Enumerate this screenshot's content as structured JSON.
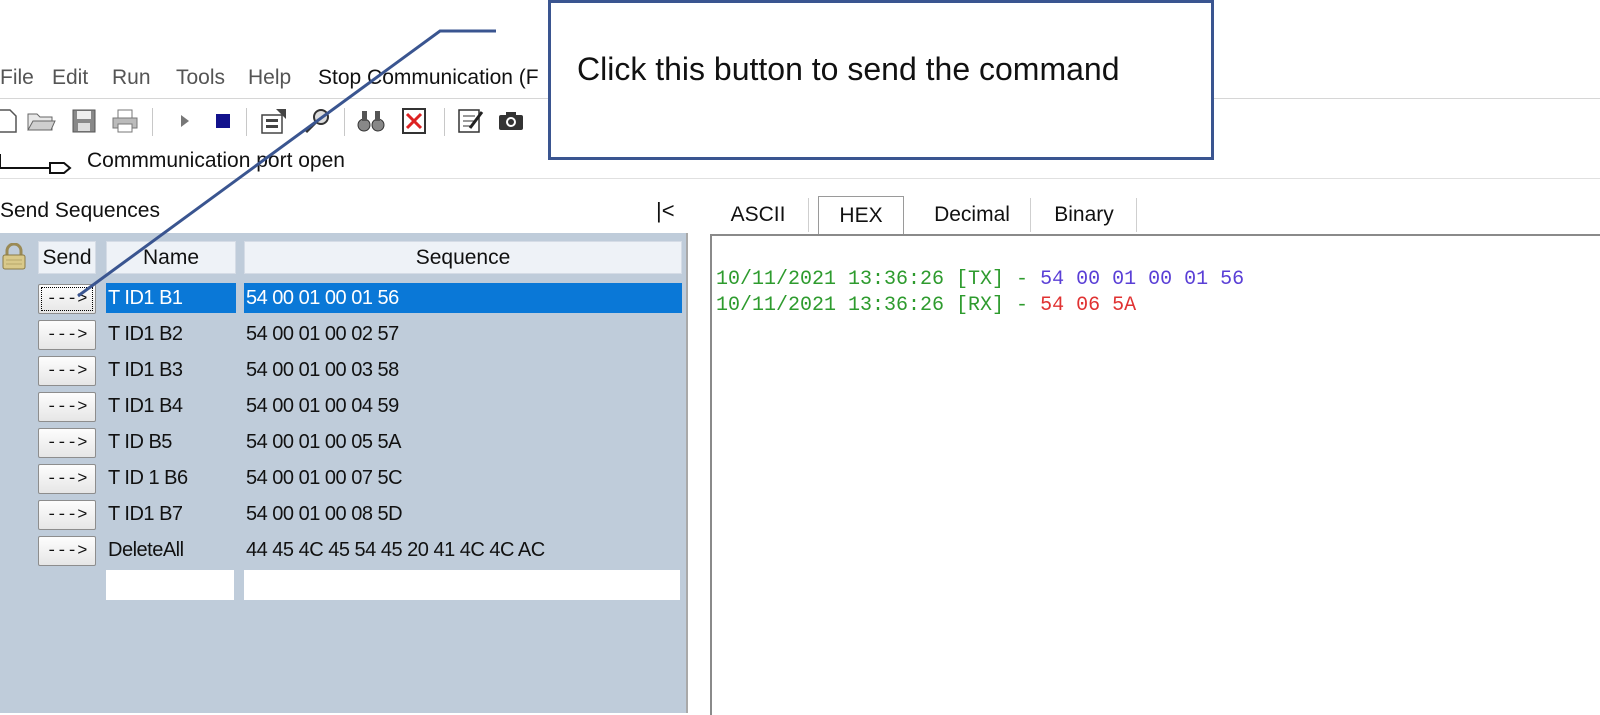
{
  "menu": {
    "file": "File",
    "edit": "Edit",
    "run": "Run",
    "tools": "Tools",
    "help": "Help",
    "stop": "Stop Communication  (F"
  },
  "toolbar": {
    "icons": [
      "new-icon",
      "open-icon",
      "save-icon",
      "print-icon",
      "play-icon",
      "stop-icon",
      "properties-icon",
      "find-key-icon",
      "binoculars-icon",
      "clear-icon",
      "edit-icon",
      "camera-icon"
    ]
  },
  "status": {
    "text": "Commmunication port open"
  },
  "send_panel": {
    "title": "Send Sequences",
    "collapse_label": "|<",
    "headers": {
      "send": "Send",
      "name": "Name",
      "sequence": "Sequence"
    },
    "button_label": "--->",
    "rows": [
      {
        "name": "T ID1 B1",
        "sequence": "54 00 01 00 01 56",
        "selected": true
      },
      {
        "name": "T ID1 B2",
        "sequence": "54 00 01 00 02 57"
      },
      {
        "name": "T ID1 B3",
        "sequence": "54 00 01 00 03 58"
      },
      {
        "name": "T ID1 B4",
        "sequence": "54 00 01 00 04 59"
      },
      {
        "name": "T ID B5",
        "sequence": "54 00 01 00 05 5A"
      },
      {
        "name": "T ID 1 B6",
        "sequence": "54 00 01 00 07 5C"
      },
      {
        "name": "T ID1 B7",
        "sequence": "54 00 01 00 08 5D"
      },
      {
        "name": "DeleteAll",
        "sequence": "44 45 4C 45 54 45 20 41 4C 4C AC"
      }
    ]
  },
  "view_tabs": {
    "ascii": "ASCII",
    "hex": "HEX",
    "decimal": "Decimal",
    "binary": "Binary",
    "active": "HEX"
  },
  "log": [
    {
      "timestamp": "10/11/2021 13:36:26 [TX] - ",
      "data": "54 00 01 00 01 56",
      "kind": "tx"
    },
    {
      "timestamp": "10/11/2021 13:36:26 [RX] - ",
      "data": "54 06 5A",
      "kind": "rx"
    }
  ],
  "colors": {
    "timestamp": "#2e9b2e",
    "tx": "#5a3fd6",
    "rx": "#e03232",
    "selection": "#0a78d7",
    "panel": "#bfccda",
    "callout_border": "#3a5590"
  },
  "callout": {
    "text": "Click this button to send the command"
  }
}
